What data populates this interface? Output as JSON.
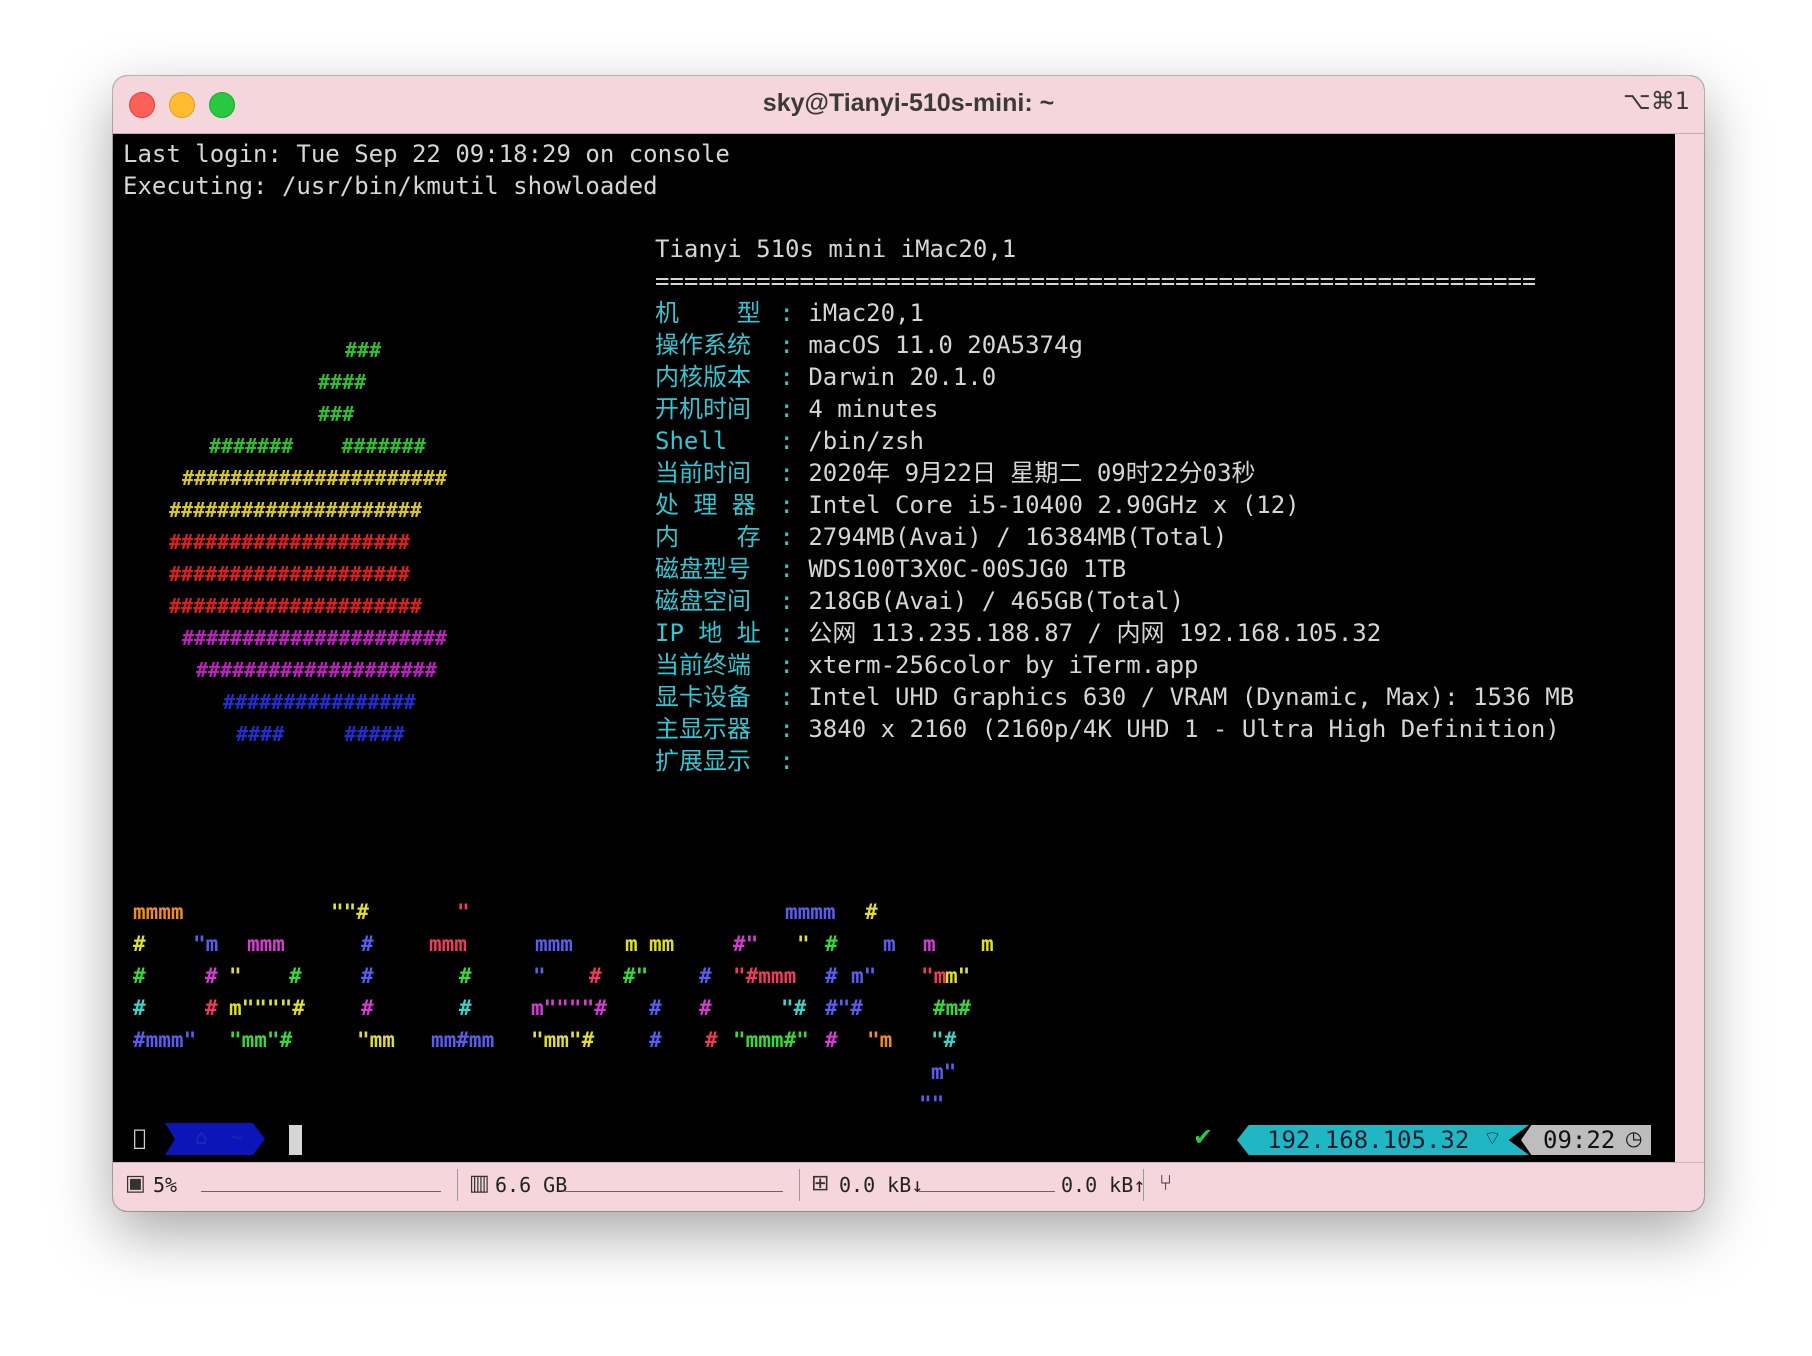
{
  "window": {
    "title": "sky@Tianyi-510s-mini: ~",
    "shortcut": "⌥⌘1"
  },
  "terminal": {
    "lines": [
      "Last login: Tue Sep 22 09:18:29 on console",
      "Executing: /usr/bin/kmutil showloaded"
    ]
  },
  "sysinfo": {
    "header": "Tianyi 510s mini iMac20,1",
    "rule": "==============================================================",
    "rows": [
      {
        "key": "机    型",
        "value": "iMac20,1"
      },
      {
        "key": "操作系统",
        "value": "macOS 11.0 20A5374g"
      },
      {
        "key": "内核版本",
        "value": "Darwin 20.1.0"
      },
      {
        "key": "开机时间",
        "value": "4 minutes"
      },
      {
        "key": "Shell",
        "value": "/bin/zsh"
      },
      {
        "key": "当前时间",
        "value": "2020年 9月22日 星期二 09时22分03秒"
      },
      {
        "key": "处 理 器",
        "value": "Intel Core i5-10400 2.90GHz x (12)"
      },
      {
        "key": "内    存",
        "value": "2794MB(Avai) / 16384MB(Total)"
      },
      {
        "key": "磁盘型号",
        "value": "WDS100T3X0C-00SJG0 1TB"
      },
      {
        "key": "磁盘空间",
        "value": "218GB(Avai) / 465GB(Total)"
      },
      {
        "key": "IP 地 址",
        "value": "公网 113.235.188.87 / 内网 192.168.105.32"
      },
      {
        "key": "当前终端",
        "value": "xterm-256color by iTerm.app"
      },
      {
        "key": "显卡设备",
        "value": "Intel UHD Graphics 630 / VRAM (Dynamic, Max): 1536 MB"
      },
      {
        "key": "主显示器",
        "value": "3840 x 2160 (2160p/4K UHD 1 - Ultra High Definition)"
      },
      {
        "key": "扩展显示",
        "value": ""
      }
    ],
    "separator": ":"
  },
  "apple_logo": {
    "rows": [
      "###",
      "####",
      "###",
      "#######    #######",
      "######################",
      "#####################",
      "####################",
      "####################",
      "#####################",
      "######################",
      "####################",
      "################",
      "####     #####"
    ]
  },
  "banner": {
    "rows": [
      [
        "mmmm",
        "\"\"#",
        "\"",
        "mmmm",
        "#"
      ],
      [
        "#",
        "\"m",
        "mmm",
        "#",
        "mmm",
        "mmm",
        "m",
        "mm",
        "#\"",
        "\"",
        "#",
        "m",
        "m",
        "m"
      ],
      [
        "#",
        "#",
        "\"",
        "#",
        "#",
        "#",
        "\"",
        "#",
        "#\"",
        "#",
        "\"#mmm",
        "#",
        "m\"",
        "\"m",
        "m\""
      ],
      [
        "#",
        "#",
        "m\"\"\"\"#",
        "#",
        "#",
        "m\"\"\"\"#",
        "#",
        "#",
        "\"#",
        "#\"#",
        "#m#"
      ],
      [
        "#mmm\"",
        "\"mm\"#",
        "\"mm",
        "mm#mm",
        "\"mm\"#",
        "#",
        "#",
        "\"mmm#\"",
        "#",
        "\"m",
        "\"#"
      ],
      [
        "m\""
      ],
      [
        "\"\""
      ]
    ]
  },
  "prompt": {
    "home_icon": "house-icon",
    "dir": "~",
    "ip": "192.168.105.32",
    "time": "09:22"
  },
  "statusbar": {
    "cpu": "5%",
    "memory": "6.6 GB",
    "net_down": "0.0 kB↓",
    "net_up": "0.0 kB↑"
  },
  "colors": {
    "titlebar": "#f6d6dd",
    "key_cyan": "#2fc7d3",
    "prompt_blue": "#0b15b8",
    "prompt_teal": "#1fb7c4",
    "prompt_gray": "#bdbdbd"
  }
}
